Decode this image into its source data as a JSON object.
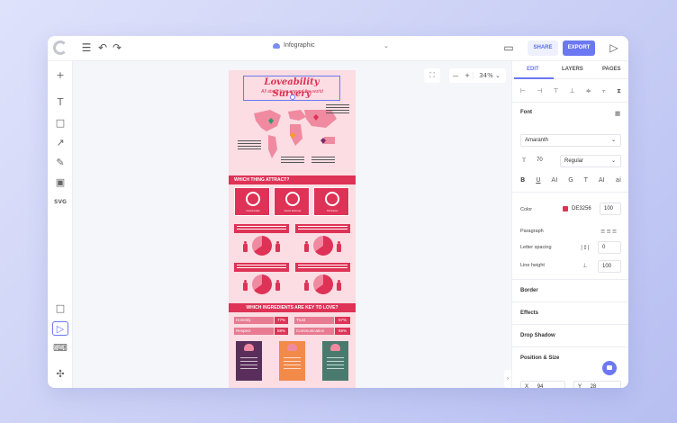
{
  "app": {
    "doc_title": "Infographic",
    "share_label": "SHARE",
    "export_label": "EXPORT",
    "zoom_level": "34%",
    "zoom_minus": "—",
    "zoom_plus": "+"
  },
  "toolbar_icons": [
    "menu-icon",
    "undo-icon",
    "redo-icon",
    "comment-icon",
    "play-icon"
  ],
  "left_tools": [
    {
      "name": "add",
      "glyph": "+"
    },
    {
      "name": "text",
      "glyph": "T"
    },
    {
      "name": "shape",
      "glyph": "□"
    },
    {
      "name": "line",
      "glyph": "↗"
    },
    {
      "name": "draw",
      "glyph": "✎"
    },
    {
      "name": "image",
      "glyph": "▣"
    },
    {
      "name": "svg",
      "glyph": "SVG"
    },
    {
      "name": "frame",
      "glyph": "□"
    },
    {
      "name": "select",
      "glyph": "▷"
    },
    {
      "name": "keyboard",
      "glyph": "⌨"
    },
    {
      "name": "plugins",
      "glyph": "✣"
    }
  ],
  "poster": {
    "title": "Loveability Survery",
    "subtitle": "All about love around the world",
    "section1": "WHICH THING ATTRACT?",
    "cards": [
      {
        "pct": "70%",
        "label": "Good looks"
      },
      {
        "pct": "40%",
        "label": "Good Humour"
      },
      {
        "pct": "85%",
        "label": "Kindness"
      }
    ],
    "questions": [
      "DO YOU THINK STARK COUPLES ARE MADE IN LOVE THAN THEY",
      "DO YOU THINK YOU CAN LOVE SOMEONE MORE THAN YOU LOVE THEM",
      "DO YOU THINK YOUR CURRENT RELATIONSHIP WILL LAST FOREVER?",
      "DO YOU ABOUT TO GIVE YOUR SOMETHING YOU LOVE IT?"
    ],
    "section2": "WHICH INGREDIENTS ARE KEY TO LOVE?",
    "ingredients": [
      {
        "name": "Honesty",
        "value": "77%"
      },
      {
        "name": "Trust",
        "value": "67%"
      },
      {
        "name": "Respect",
        "value": "58%"
      },
      {
        "name": "Communication",
        "value": "65%"
      }
    ],
    "tile_colors": [
      "#5a2e5a",
      "#f28a4a",
      "#4a7a6e"
    ]
  },
  "panel": {
    "tabs": [
      "EDIT",
      "LAYERS",
      "PAGES"
    ],
    "font_label": "Font",
    "font_family": "Amaranth",
    "font_size": "70",
    "font_weight": "Regular",
    "format_buttons": [
      "B",
      "U",
      "AI",
      "G",
      "T",
      "AI",
      "ai"
    ],
    "color_label": "Color",
    "color_hex": "DE3256",
    "color_opacity": "100",
    "paragraph_label": "Paragraph",
    "letter_spacing_label": "Letter spacing",
    "letter_spacing": "0",
    "line_height_label": "Line height",
    "line_height": "100",
    "sections": [
      "Border",
      "Effects",
      "Drop Shadow",
      "Position & Size"
    ],
    "x_label": "X",
    "x_value": "94",
    "y_label": "Y",
    "y_value": "28"
  },
  "colors": {
    "accent": "#6b78f2",
    "poster_red": "#de3256",
    "poster_bg": "#fbdde3"
  }
}
